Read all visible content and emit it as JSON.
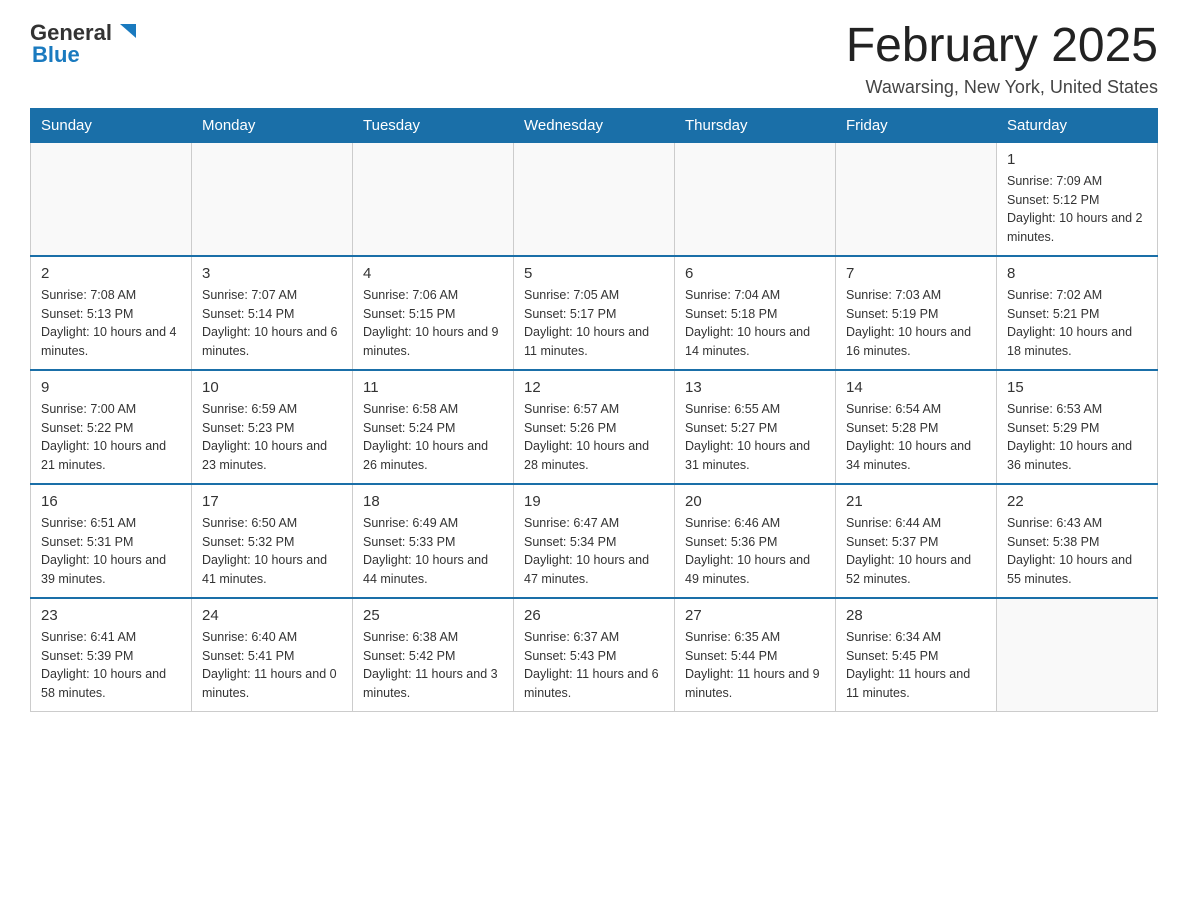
{
  "logo": {
    "general": "General",
    "blue": "Blue",
    "arrow_color": "#1a7abf"
  },
  "header": {
    "title": "February 2025",
    "subtitle": "Wawarsing, New York, United States"
  },
  "weekdays": [
    "Sunday",
    "Monday",
    "Tuesday",
    "Wednesday",
    "Thursday",
    "Friday",
    "Saturday"
  ],
  "weeks": [
    [
      {
        "day": "",
        "info": ""
      },
      {
        "day": "",
        "info": ""
      },
      {
        "day": "",
        "info": ""
      },
      {
        "day": "",
        "info": ""
      },
      {
        "day": "",
        "info": ""
      },
      {
        "day": "",
        "info": ""
      },
      {
        "day": "1",
        "info": "Sunrise: 7:09 AM\nSunset: 5:12 PM\nDaylight: 10 hours and 2 minutes."
      }
    ],
    [
      {
        "day": "2",
        "info": "Sunrise: 7:08 AM\nSunset: 5:13 PM\nDaylight: 10 hours and 4 minutes."
      },
      {
        "day": "3",
        "info": "Sunrise: 7:07 AM\nSunset: 5:14 PM\nDaylight: 10 hours and 6 minutes."
      },
      {
        "day": "4",
        "info": "Sunrise: 7:06 AM\nSunset: 5:15 PM\nDaylight: 10 hours and 9 minutes."
      },
      {
        "day": "5",
        "info": "Sunrise: 7:05 AM\nSunset: 5:17 PM\nDaylight: 10 hours and 11 minutes."
      },
      {
        "day": "6",
        "info": "Sunrise: 7:04 AM\nSunset: 5:18 PM\nDaylight: 10 hours and 14 minutes."
      },
      {
        "day": "7",
        "info": "Sunrise: 7:03 AM\nSunset: 5:19 PM\nDaylight: 10 hours and 16 minutes."
      },
      {
        "day": "8",
        "info": "Sunrise: 7:02 AM\nSunset: 5:21 PM\nDaylight: 10 hours and 18 minutes."
      }
    ],
    [
      {
        "day": "9",
        "info": "Sunrise: 7:00 AM\nSunset: 5:22 PM\nDaylight: 10 hours and 21 minutes."
      },
      {
        "day": "10",
        "info": "Sunrise: 6:59 AM\nSunset: 5:23 PM\nDaylight: 10 hours and 23 minutes."
      },
      {
        "day": "11",
        "info": "Sunrise: 6:58 AM\nSunset: 5:24 PM\nDaylight: 10 hours and 26 minutes."
      },
      {
        "day": "12",
        "info": "Sunrise: 6:57 AM\nSunset: 5:26 PM\nDaylight: 10 hours and 28 minutes."
      },
      {
        "day": "13",
        "info": "Sunrise: 6:55 AM\nSunset: 5:27 PM\nDaylight: 10 hours and 31 minutes."
      },
      {
        "day": "14",
        "info": "Sunrise: 6:54 AM\nSunset: 5:28 PM\nDaylight: 10 hours and 34 minutes."
      },
      {
        "day": "15",
        "info": "Sunrise: 6:53 AM\nSunset: 5:29 PM\nDaylight: 10 hours and 36 minutes."
      }
    ],
    [
      {
        "day": "16",
        "info": "Sunrise: 6:51 AM\nSunset: 5:31 PM\nDaylight: 10 hours and 39 minutes."
      },
      {
        "day": "17",
        "info": "Sunrise: 6:50 AM\nSunset: 5:32 PM\nDaylight: 10 hours and 41 minutes."
      },
      {
        "day": "18",
        "info": "Sunrise: 6:49 AM\nSunset: 5:33 PM\nDaylight: 10 hours and 44 minutes."
      },
      {
        "day": "19",
        "info": "Sunrise: 6:47 AM\nSunset: 5:34 PM\nDaylight: 10 hours and 47 minutes."
      },
      {
        "day": "20",
        "info": "Sunrise: 6:46 AM\nSunset: 5:36 PM\nDaylight: 10 hours and 49 minutes."
      },
      {
        "day": "21",
        "info": "Sunrise: 6:44 AM\nSunset: 5:37 PM\nDaylight: 10 hours and 52 minutes."
      },
      {
        "day": "22",
        "info": "Sunrise: 6:43 AM\nSunset: 5:38 PM\nDaylight: 10 hours and 55 minutes."
      }
    ],
    [
      {
        "day": "23",
        "info": "Sunrise: 6:41 AM\nSunset: 5:39 PM\nDaylight: 10 hours and 58 minutes."
      },
      {
        "day": "24",
        "info": "Sunrise: 6:40 AM\nSunset: 5:41 PM\nDaylight: 11 hours and 0 minutes."
      },
      {
        "day": "25",
        "info": "Sunrise: 6:38 AM\nSunset: 5:42 PM\nDaylight: 11 hours and 3 minutes."
      },
      {
        "day": "26",
        "info": "Sunrise: 6:37 AM\nSunset: 5:43 PM\nDaylight: 11 hours and 6 minutes."
      },
      {
        "day": "27",
        "info": "Sunrise: 6:35 AM\nSunset: 5:44 PM\nDaylight: 11 hours and 9 minutes."
      },
      {
        "day": "28",
        "info": "Sunrise: 6:34 AM\nSunset: 5:45 PM\nDaylight: 11 hours and 11 minutes."
      },
      {
        "day": "",
        "info": ""
      }
    ]
  ]
}
